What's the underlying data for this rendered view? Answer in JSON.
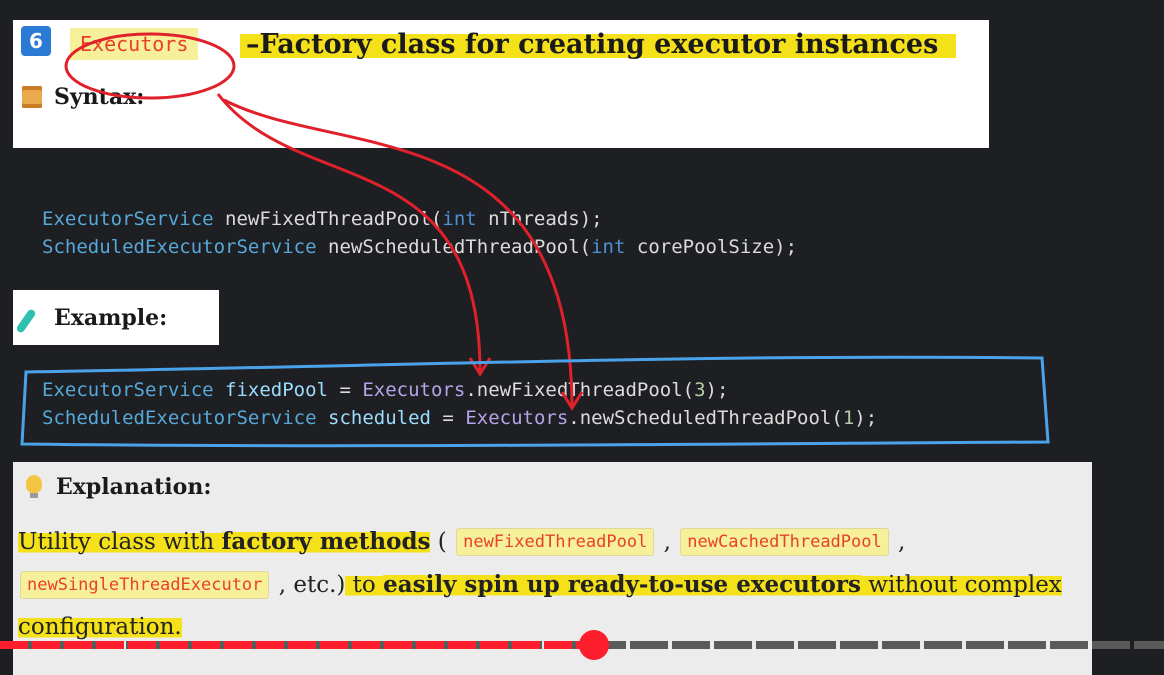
{
  "section": {
    "number": "6",
    "class_name": "Executors",
    "title": "–Factory class for creating executor instances"
  },
  "syntax": {
    "label": "Syntax:",
    "icon": "scroll-icon",
    "line1": {
      "type": "ExecutorService",
      "method": "newFixedThreadPool(",
      "kw": "int",
      "param": "nThreads",
      "end": ");"
    },
    "line2": {
      "type": "ScheduledExecutorService",
      "method": "newScheduledThreadPool(",
      "kw": "int",
      "param": "corePoolSize",
      "end": ");"
    }
  },
  "example": {
    "label": "Example:",
    "icon": "test-tube-icon",
    "line1": {
      "type": "ExecutorService",
      "var": "fixedPool",
      "eq": "=",
      "cls": "Executors",
      "call": ".newFixedThreadPool(",
      "arg": "3",
      "end": ");"
    },
    "line2": {
      "type": "ScheduledExecutorService",
      "var": "scheduled",
      "eq": "=",
      "cls": "Executors",
      "call": ".newScheduledThreadPool(",
      "arg": "1",
      "end": ");"
    }
  },
  "explanation": {
    "label": "Explanation:",
    "icon": "lightbulb-icon",
    "p1_a": "Utility class with ",
    "p1_bold": "factory methods",
    "p1_b": " (",
    "chip1": "newFixedThreadPool",
    "comma1": ",",
    "chip2": "newCachedThreadPool",
    "comma2": ",",
    "chip3": "newSingleThreadExecutor",
    "p2_a": ", etc.)",
    "p2_b": " to ",
    "p2_bold": "easily spin up ready-to-use executors",
    "p2_c": " without complex",
    "p3": "configuration."
  },
  "video": {
    "progress": 0.51
  },
  "colors": {
    "accent_red": "#e0202a",
    "annot_blue": "#4aa3e8",
    "highlight": "#f4e11a"
  }
}
